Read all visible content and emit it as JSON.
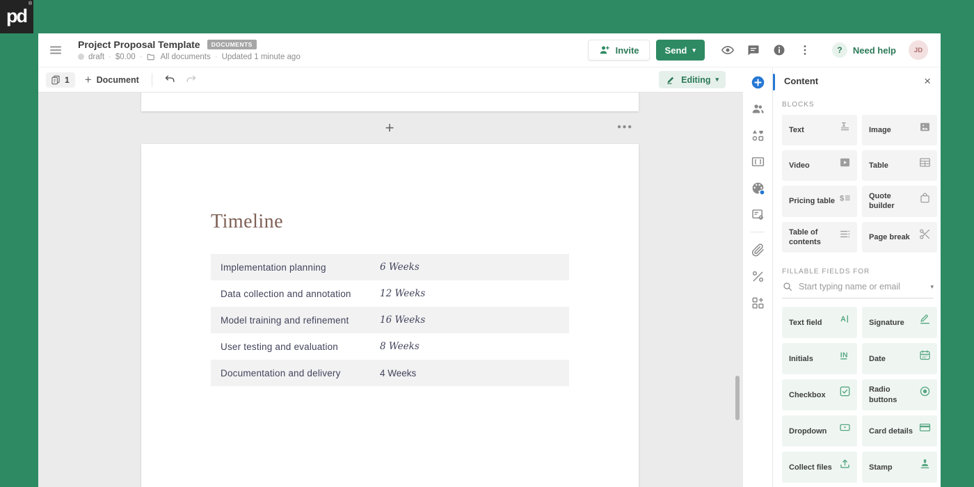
{
  "colors": {
    "brand_green": "#2e8a63",
    "accent_blue": "#2577d4",
    "canvas_gray": "#ebebeb",
    "heading_brown": "#7f6156"
  },
  "brand": {
    "logo_text": "pd",
    "registered": "®"
  },
  "icons": {
    "caret_down": "▾",
    "close": "×",
    "more": "●●●",
    "insert_plus": "+",
    "add_plus": "+",
    "question_mark": "?",
    "separator": "·"
  },
  "header": {
    "title": "Project Proposal Template",
    "badge": "DOCUMENTS",
    "status": "draft",
    "amount": "$0.00",
    "folder": "All documents",
    "updated": "Updated 1 minute ago",
    "invite_label": "Invite",
    "send_label": "Send",
    "need_help_label": "Need help",
    "avatar_initials": "JD"
  },
  "toolbar": {
    "page_count": "1",
    "add_document_label": "Document",
    "editing_label": "Editing"
  },
  "document": {
    "heading": "Timeline",
    "timeline_rows": [
      {
        "phase": "Implementation planning",
        "duration": "6 Weeks",
        "italic": true
      },
      {
        "phase": "Data collection and annotation",
        "duration": "12 Weeks",
        "italic": true
      },
      {
        "phase": "Model training and refinement",
        "duration": "16 Weeks",
        "italic": true
      },
      {
        "phase": "User testing and evaluation",
        "duration": "8 Weeks",
        "italic": true
      },
      {
        "phase": "Documentation and delivery",
        "duration": "4 Weeks",
        "italic": false
      }
    ]
  },
  "sidebar": {
    "panel_title": "Content",
    "blocks_label": "BLOCKS",
    "fillable_label": "FILLABLE FIELDS FOR",
    "search_placeholder": "Start typing name or email",
    "strip": [
      {
        "name": "add-content",
        "icon": "icon-plus-circle",
        "active": true
      },
      {
        "name": "recipients",
        "icon": "icon-users"
      },
      {
        "name": "content-library",
        "icon": "icon-shapes"
      },
      {
        "name": "variables",
        "icon": "icon-brackets"
      },
      {
        "name": "design-theme",
        "icon": "icon-palette"
      },
      {
        "name": "document-settings",
        "icon": "icon-doc-gear"
      },
      {
        "name": "attachments",
        "icon": "icon-paperclip",
        "divider": true
      },
      {
        "name": "pricing",
        "icon": "icon-percent"
      },
      {
        "name": "add-apps",
        "icon": "icon-apps-add"
      }
    ],
    "blocks": [
      {
        "name": "text",
        "label": "Text",
        "icon": "icon-text"
      },
      {
        "name": "image",
        "label": "Image",
        "icon": "icon-image"
      },
      {
        "name": "video",
        "label": "Video",
        "icon": "icon-video"
      },
      {
        "name": "table",
        "label": "Table",
        "icon": "icon-table"
      },
      {
        "name": "pricing-table",
        "label": "Pricing table",
        "icon": "icon-pricing"
      },
      {
        "name": "quote-builder",
        "label": "Quote builder",
        "icon": "icon-bag"
      },
      {
        "name": "table-of-contents",
        "label": "Table of contents",
        "icon": "icon-toc"
      },
      {
        "name": "page-break",
        "label": "Page break",
        "icon": "icon-scissors"
      }
    ],
    "fields": [
      {
        "name": "text-field",
        "label": "Text field",
        "icon": "icon-textfield"
      },
      {
        "name": "signature",
        "label": "Signature",
        "icon": "icon-signature"
      },
      {
        "name": "initials",
        "label": "Initials",
        "icon": "icon-initials"
      },
      {
        "name": "date",
        "label": "Date",
        "icon": "icon-calendar"
      },
      {
        "name": "checkbox",
        "label": "Checkbox",
        "icon": "icon-checkbox"
      },
      {
        "name": "radio-buttons",
        "label": "Radio buttons",
        "icon": "icon-radio"
      },
      {
        "name": "dropdown",
        "label": "Dropdown",
        "icon": "icon-dropdown"
      },
      {
        "name": "card-details",
        "label": "Card details",
        "icon": "icon-card"
      },
      {
        "name": "collect-files",
        "label": "Collect files",
        "icon": "icon-upload"
      },
      {
        "name": "stamp",
        "label": "Stamp",
        "icon": "icon-stamp"
      }
    ]
  }
}
